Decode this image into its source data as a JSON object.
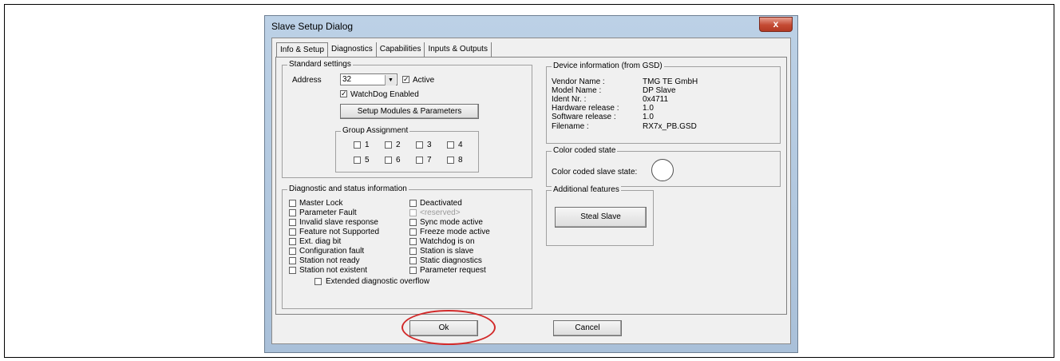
{
  "window": {
    "title": "Slave Setup Dialog",
    "close_glyph": "x"
  },
  "tabs": [
    "Info & Setup",
    "Diagnostics",
    "Capabilities",
    "Inputs & Outputs"
  ],
  "standard": {
    "legend": "Standard settings",
    "address_label": "Address",
    "address_value": "32",
    "active_label": "Active",
    "active_checked": true,
    "watchdog_label": "WatchDog Enabled",
    "watchdog_checked": true,
    "setup_button": "Setup Modules & Parameters",
    "group_legend": "Group Assignment",
    "groups": [
      "1",
      "2",
      "3",
      "4",
      "5",
      "6",
      "7",
      "8"
    ]
  },
  "device": {
    "legend": "Device information (from GSD)",
    "rows": [
      {
        "label": "Vendor Name :",
        "value": "TMG TE GmbH"
      },
      {
        "label": "Model Name :",
        "value": "DP Slave"
      },
      {
        "label": "Ident Nr. :",
        "value": "0x4711"
      },
      {
        "label": "Hardware release :",
        "value": "1.0"
      },
      {
        "label": "Software release :",
        "value": "1.0"
      },
      {
        "label": "Filename :",
        "value": "RX7x_PB.GSD"
      }
    ]
  },
  "color_state": {
    "legend": "Color coded state",
    "label": "Color coded slave state:"
  },
  "diag": {
    "legend": "Diagnostic and status information",
    "left": [
      "Master Lock",
      "Parameter Fault",
      "Invalid slave response",
      "Feature not Supported",
      "Ext. diag bit",
      "Configuration fault",
      "Station not ready",
      "Station not existent"
    ],
    "right": [
      "Deactivated",
      "<reserved>",
      "Sync mode active",
      "Freeze mode active",
      "Watchdog is on",
      "Station is slave",
      "Static diagnostics",
      "Parameter request"
    ],
    "overflow": "Extended diagnostic overflow"
  },
  "additional": {
    "legend": "Additional features",
    "steal_button": "Steal Slave"
  },
  "footer": {
    "ok": "Ok",
    "cancel": "Cancel"
  },
  "colors": {
    "highlight_oval": "#d22a2a",
    "title_bar": "#bcd1e6"
  }
}
